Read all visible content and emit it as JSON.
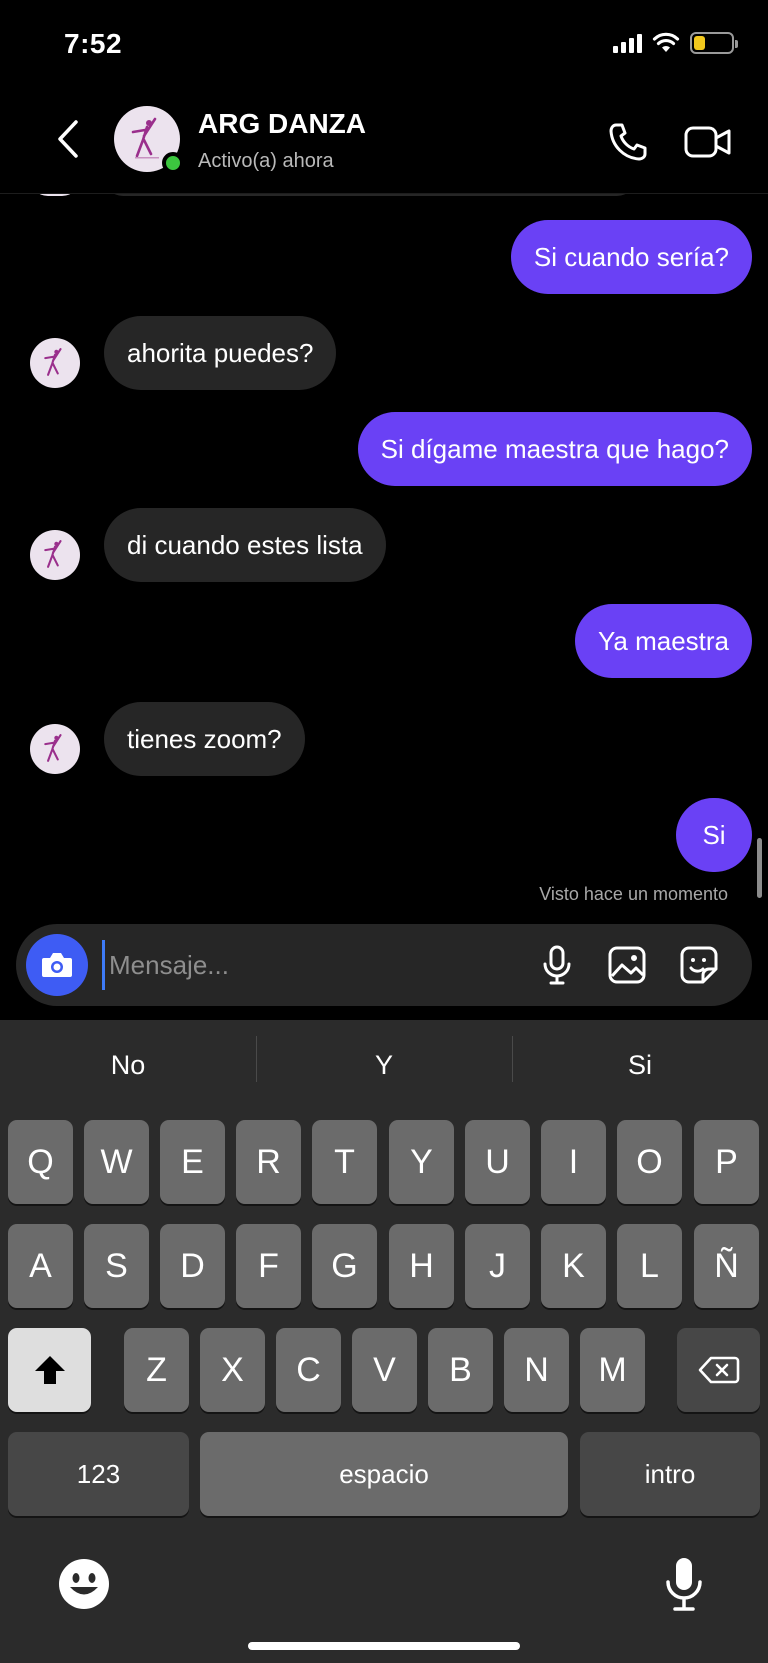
{
  "status_bar": {
    "time": "7:52",
    "battery_color": "#f2c81d"
  },
  "header": {
    "contact_name": "ARG DANZA",
    "contact_status": "Activo(a) ahora",
    "back_icon": "chevron-left-icon",
    "call_icon": "phone-icon",
    "video_icon": "video-camera-icon"
  },
  "messages": [
    {
      "side": "sent",
      "text": "Si cuando sería?"
    },
    {
      "side": "received",
      "text": "ahorita puedes?"
    },
    {
      "side": "sent",
      "text": "Si dígame maestra que hago?"
    },
    {
      "side": "received",
      "text": "di cuando estes lista"
    },
    {
      "side": "sent",
      "text": "Ya maestra"
    },
    {
      "side": "received",
      "text": "tienes zoom?"
    },
    {
      "side": "sent",
      "text": "Si"
    }
  ],
  "seen_text": "Visto hace un momento",
  "composer": {
    "placeholder": "Mensaje...",
    "value": ""
  },
  "keyboard": {
    "suggestions": [
      "No",
      "Y",
      "Si"
    ],
    "row1": [
      "Q",
      "W",
      "E",
      "R",
      "T",
      "Y",
      "U",
      "I",
      "O",
      "P"
    ],
    "row2": [
      "A",
      "S",
      "D",
      "F",
      "G",
      "H",
      "J",
      "K",
      "L",
      "Ñ"
    ],
    "row3": [
      "Z",
      "X",
      "C",
      "V",
      "B",
      "N",
      "M"
    ],
    "numbers_label": "123",
    "space_label": "espacio",
    "return_label": "intro"
  },
  "colors": {
    "sent_bubble": "#6a41f5",
    "received_bubble": "#262626",
    "camera_button": "#3e5cf4",
    "online_dot": "#3cc63f"
  }
}
